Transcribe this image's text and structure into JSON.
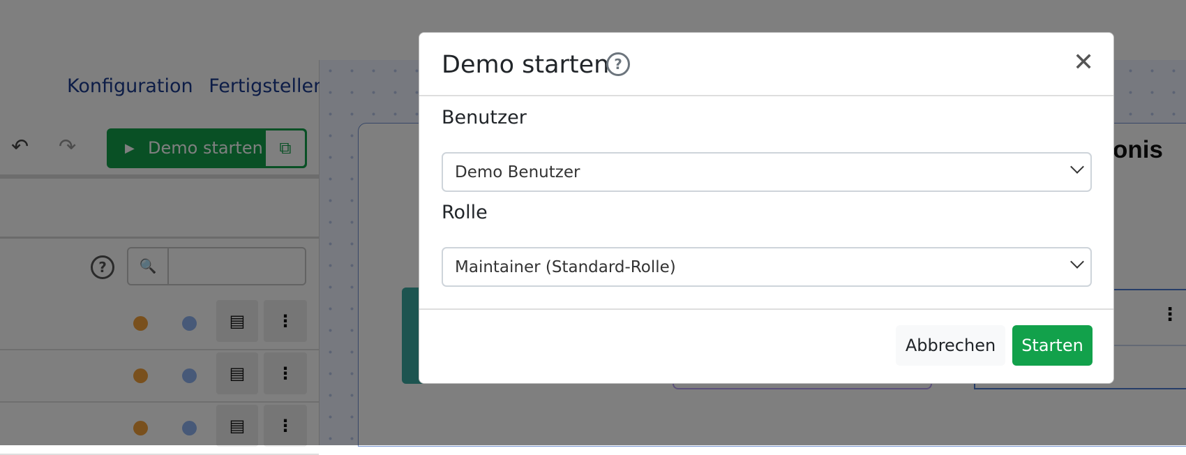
{
  "nav": {
    "configuration": "Konfiguration",
    "finish": "Fertigstellen"
  },
  "toolbar": {
    "undo_icon": "undo-icon",
    "redo_icon": "redo-icon",
    "demo_start_label": "Demo starten",
    "play_glyph": "▶",
    "external_glyph": "⧉"
  },
  "sidebar": {
    "help_glyph": "?",
    "search_glyph": "🔍",
    "search_value": "",
    "rows": [
      {
        "status_colors": [
          "#f3a13a",
          "#8fb3f0"
        ]
      },
      {
        "status_colors": [
          "#f3a13a",
          "#8fb3f0"
        ]
      },
      {
        "status_colors": [
          "#f3a13a",
          "#8fb3f0"
        ]
      }
    ]
  },
  "canvas": {
    "partial_title": "onis"
  },
  "modal": {
    "title": "Demo starten",
    "help_glyph": "?",
    "close_glyph": "✕",
    "user_label": "Benutzer",
    "user_value": "Demo Benutzer",
    "role_label": "Rolle",
    "role_value": "Maintainer (Standard-Rolle)",
    "cancel_label": "Abbrechen",
    "start_label": "Starten"
  },
  "colors": {
    "accent_green": "#12a14b",
    "link_blue": "#1b3a8f",
    "overlay": "rgba(0,0,0,0.5)"
  }
}
